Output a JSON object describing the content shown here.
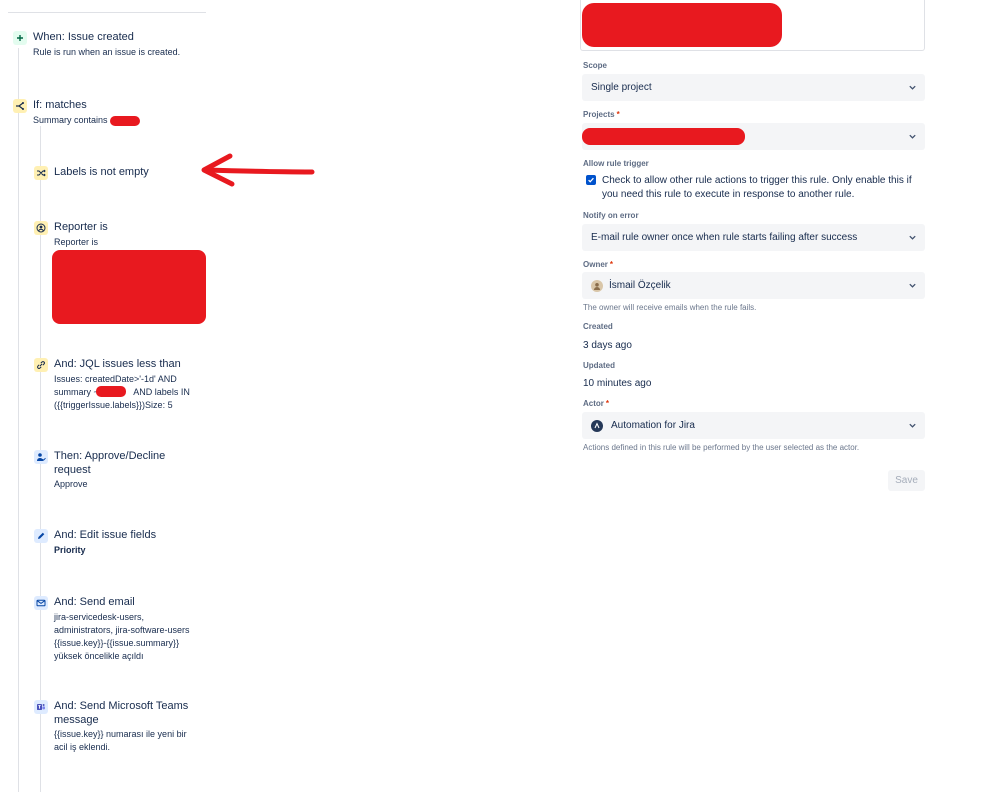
{
  "rule": {
    "trigger": {
      "title": "When: Issue created",
      "description": "Rule is run when an issue is created."
    },
    "condition_matches": {
      "title": "If: matches",
      "description": "Summary contains"
    },
    "labels_condition": {
      "title": "Labels is not empty"
    },
    "reporter_condition": {
      "title": "Reporter is",
      "description": "Reporter is"
    },
    "jql_condition": {
      "title": "And: JQL issues less than",
      "line1": "Issues: createdDate>'-1d' AND",
      "line2a": "summary ~",
      "line2b": "AND labels IN",
      "line3": "({{triggerIssue.labels}})Size: 5"
    },
    "approve_action": {
      "title": "Then: Approve/Decline request",
      "description": "Approve"
    },
    "edit_action": {
      "title": "And: Edit issue fields",
      "description": "Priority"
    },
    "email_action": {
      "title": "And: Send email",
      "line1": "jira-servicedesk-users,",
      "line2": "administrators, jira-software-users",
      "line3": "{{issue.key}}-{{issue.summary}}",
      "line4": "yüksek öncelikle açıldı"
    },
    "teams_action": {
      "title": "And: Send Microsoft Teams message",
      "line1": "{{issue.key}} numarası ile yeni bir",
      "line2": "acil iş eklendi."
    }
  },
  "details": {
    "scope": {
      "label": "Scope",
      "value": "Single project"
    },
    "projects": {
      "label": "Projects",
      "required": "*"
    },
    "allow_rule_trigger": {
      "label": "Allow rule trigger",
      "text": "Check to allow other rule actions to trigger this rule. Only enable this if you need this rule to execute in response to another rule.",
      "checked": true
    },
    "notify_on_error": {
      "label": "Notify on error",
      "value": "E-mail rule owner once when rule starts failing after success"
    },
    "owner": {
      "label": "Owner",
      "required": "*",
      "value": "İsmail Özçelik",
      "helper": "The owner will receive emails when the rule fails."
    },
    "created": {
      "label": "Created",
      "value": "3 days ago"
    },
    "updated": {
      "label": "Updated",
      "value": "10 minutes ago"
    },
    "actor": {
      "label": "Actor",
      "required": "*",
      "value": "Automation for Jira",
      "helper": "Actions defined in this rule will be performed by the user selected as the actor."
    },
    "save_label": "Save"
  },
  "colors": {
    "annotation_red": "#e8191f",
    "primary_blue": "#0052cc",
    "field_background": "#f4f5f7"
  }
}
